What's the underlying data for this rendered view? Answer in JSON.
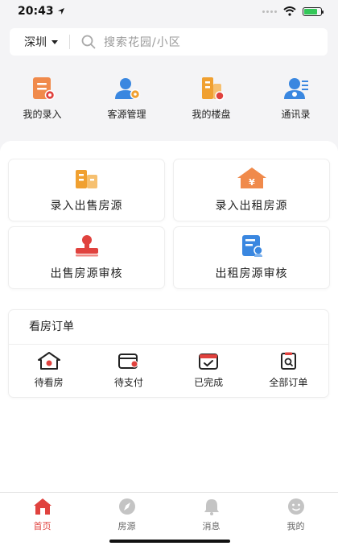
{
  "status_bar": {
    "time": "20:43",
    "battery_level": 0.8
  },
  "search": {
    "city": "深圳",
    "placeholder": "搜索花园/小区"
  },
  "quick_nav": [
    {
      "label": "我的录入",
      "icon": "form-entry-icon"
    },
    {
      "label": "客源管理",
      "icon": "client-manage-icon"
    },
    {
      "label": "我的楼盘",
      "icon": "building-icon"
    },
    {
      "label": "通讯录",
      "icon": "contacts-icon"
    }
  ],
  "tiles": [
    {
      "label": "录入出售房源",
      "icon": "sale-building-icon"
    },
    {
      "label": "录入出租房源",
      "icon": "rent-house-icon"
    },
    {
      "label": "出售房源审核",
      "icon": "stamp-icon"
    },
    {
      "label": "出租房源审核",
      "icon": "review-doc-icon"
    }
  ],
  "orders": {
    "title": "看房订单",
    "items": [
      {
        "label": "待看房",
        "icon": "house-pending-icon"
      },
      {
        "label": "待支付",
        "icon": "wallet-icon"
      },
      {
        "label": "已完成",
        "icon": "calendar-check-icon"
      },
      {
        "label": "全部订单",
        "icon": "clipboard-search-icon"
      }
    ]
  },
  "tabbar": {
    "items": [
      {
        "label": "首页",
        "active": true
      },
      {
        "label": "房源",
        "active": false
      },
      {
        "label": "消息",
        "active": false
      },
      {
        "label": "我的",
        "active": false
      }
    ]
  },
  "colors": {
    "accent": "#e0423e",
    "orange": "#f0a030",
    "blue": "#3a87e0",
    "inactive": "#c4c4c4"
  }
}
